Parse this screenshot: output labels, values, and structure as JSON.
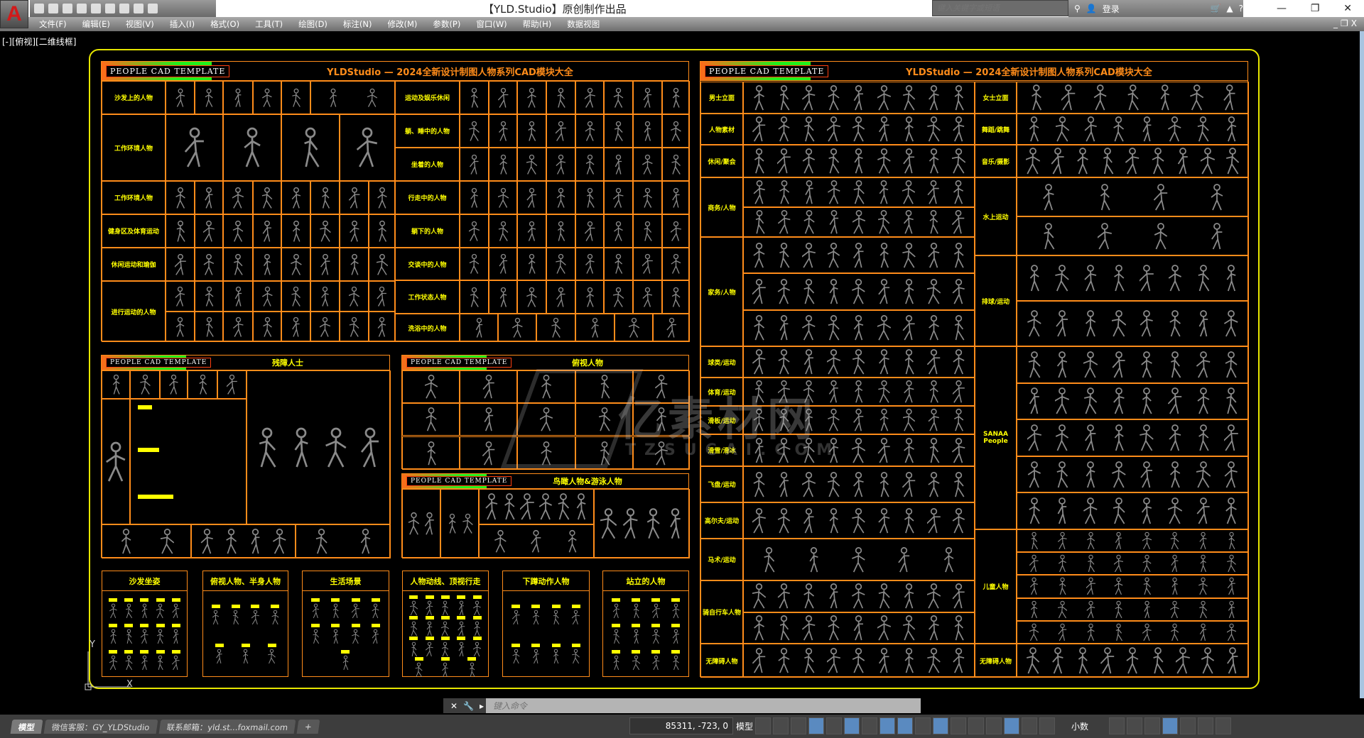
{
  "app": {
    "title": "【YLD.Studio】原创制作出品",
    "logo": "A",
    "search_placeholder": "键入关键字或短语",
    "login": "登录",
    "viewport_label": "[-][俯视][二维线框]"
  },
  "menu": [
    "文件(F)",
    "编辑(E)",
    "视图(V)",
    "插入(I)",
    "格式(O)",
    "工具(T)",
    "绘图(D)",
    "标注(N)",
    "修改(M)",
    "参数(P)",
    "窗口(W)",
    "帮助(H)",
    "数据视图"
  ],
  "drawing": {
    "badge": "PEOPLE  CAD  TEMPLATE",
    "main_title": "YLDStudio — 2024全新设计制图人物系列CAD模块大全",
    "top_left_labels": [
      "沙发上的人物",
      "工作环境人物",
      "工作环境人物",
      "健身区及体育运动",
      "休闲运动和瑜伽",
      "进行运动的人物"
    ],
    "top_mid_labels": [
      "运动及娱乐休闲",
      "躺、睡中的人物",
      "坐着的人物",
      "行走中的人物",
      "躺下的人物",
      "交谈中的人物",
      "工作状态人物",
      "洗浴中的人物"
    ],
    "right_left_labels": [
      "男士立面",
      "人物素材",
      "休闲/聚会",
      "商务/人物",
      "家务/人物",
      "球类/运动",
      "体育/运动",
      "滑板/运动",
      "滑雪/滑冰",
      "飞盘/运动",
      "高尔夫/运动",
      "马术/运动",
      "骑自行车人物",
      "无障碍人物"
    ],
    "right_right_labels": [
      "女士立面",
      "舞蹈/跳舞",
      "音乐/摄影",
      "水上运动",
      "排球/运动",
      "SANAA People",
      "儿童人物",
      "无障碍人物"
    ],
    "panel_disabled": "残障人士",
    "panel_topview": "俯视人物",
    "panel_aerial": "鸟瞰人物&游泳人物",
    "bottom_panels": [
      "沙发坐姿",
      "俯视人物、半身人物",
      "生活场景",
      "人物动线、顶视行走",
      "下蹲动作人物",
      "站立的人物"
    ],
    "watermark": "亿素材网",
    "watermark_url": "TZSUCAI.COM"
  },
  "command": {
    "placeholder": "键入命令"
  },
  "status": {
    "tabs": [
      "模型",
      "微信客服：GY_YLDStudio",
      "联系邮箱：yld.st...foxmail.com",
      "+"
    ],
    "coords": "85311, -723, 0",
    "model": "模型",
    "units": "小数"
  }
}
